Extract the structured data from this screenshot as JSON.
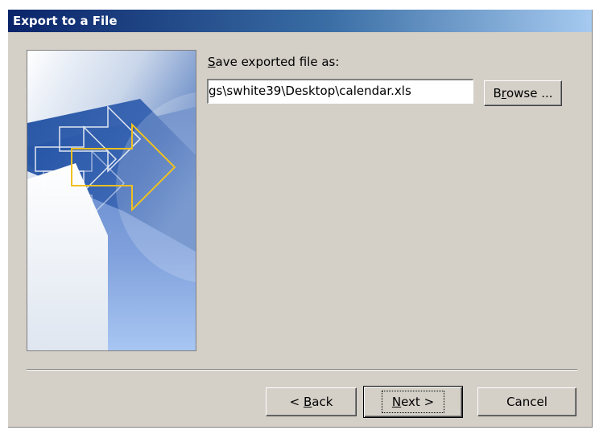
{
  "window": {
    "title": "Export to a File"
  },
  "form": {
    "save_label_prefix": "",
    "save_label_mnemonic": "S",
    "save_label_rest": "ave exported file as:",
    "path_value": "gs\\swhite39\\Desktop\\calendar.xls"
  },
  "buttons": {
    "browse_prefix": "B",
    "browse_mnemonic": "r",
    "browse_rest": "owse ...",
    "back_prefix": "< ",
    "back_mnemonic": "B",
    "back_rest": "ack",
    "next_mnemonic": "N",
    "next_rest": "ext >",
    "cancel": "Cancel"
  },
  "colors": {
    "dialog_bg": "#d4d0c8",
    "title_start": "#0a246a",
    "title_end": "#a6caf0",
    "arrow_outline": "#f0c020"
  },
  "icons": {
    "wizard_image": "export-arrows-graphic"
  }
}
